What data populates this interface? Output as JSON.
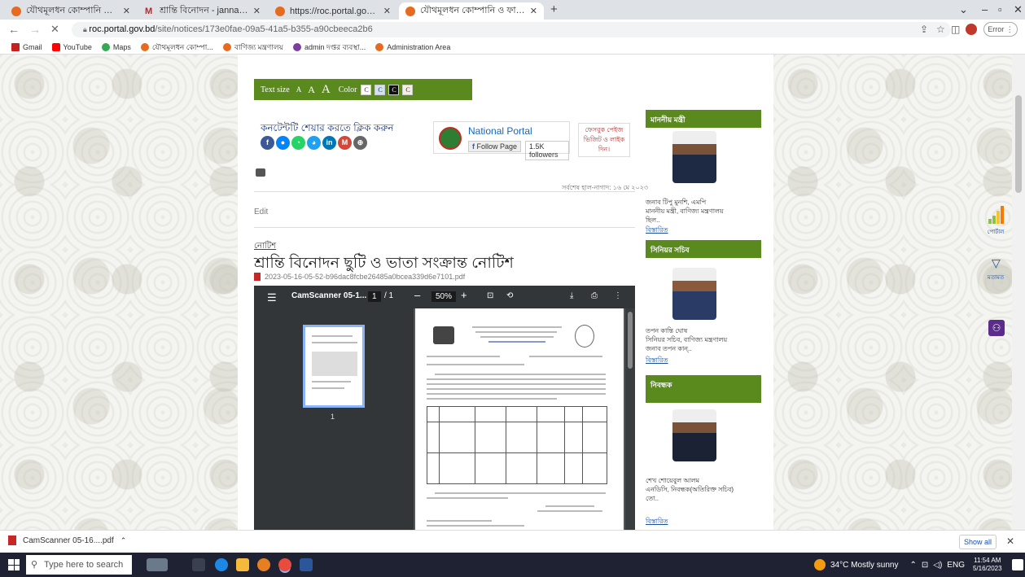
{
  "tabs": [
    {
      "title": "যৌথমূলধন কোম্পানি ও ফার্মসমূহে",
      "active": false,
      "icon": "roc-icon"
    },
    {
      "title": "শ্রান্তি বিনোদন - jannatulruma18",
      "active": false,
      "icon": "gmail-icon"
    },
    {
      "title": "https://roc.portal.gov.bd/npfadm",
      "active": false,
      "icon": "roc-icon"
    },
    {
      "title": "যৌথমূলধন কোম্পানি ও ফার্মসমূহে",
      "active": true,
      "icon": "roc-icon"
    }
  ],
  "new_tab": "+",
  "window": {
    "minimize": "–",
    "maximize": "▫",
    "close": "✕",
    "chevron": "⌄"
  },
  "omnibox": {
    "domain": "roc.portal.gov.bd",
    "path": "/site/notices/173e0fae-09a5-41a5-b355-a90cbeeca2b6"
  },
  "profile_error": "Error",
  "bookmarks": [
    {
      "label": "Gmail",
      "color": "#c5221f"
    },
    {
      "label": "YouTube",
      "color": "#ff0000"
    },
    {
      "label": "Maps",
      "color": "#34a853"
    },
    {
      "label": "যৌথমূলধন কোম্পা...",
      "color": "#e66a1f"
    },
    {
      "label": "বাণিজ্য মন্ত্রণালয়",
      "color": "#e66a1f"
    },
    {
      "label": "admin দপ্তর ব্যবস্থা...",
      "color": "#7b3fa0"
    },
    {
      "label": "Administration Area",
      "color": "#e66a1f"
    }
  ],
  "textsize": {
    "label": "Text size",
    "a_small": "A",
    "a_mid": "A",
    "a_large": "A",
    "color_label": "Color",
    "c": "C"
  },
  "share": {
    "title": "কনটেন্টটি শেয়ার করতে ক্লিক করুন",
    "icons": [
      {
        "name": "facebook",
        "color": "#3b5998",
        "glyph": "f"
      },
      {
        "name": "messenger",
        "color": "#0084ff",
        "glyph": "●"
      },
      {
        "name": "whatsapp",
        "color": "#25d366",
        "glyph": "◔"
      },
      {
        "name": "twitter",
        "color": "#1da1f2",
        "glyph": "◕"
      },
      {
        "name": "linkedin",
        "color": "#0077b5",
        "glyph": "in"
      },
      {
        "name": "gmail",
        "color": "#d44638",
        "glyph": "M"
      },
      {
        "name": "more",
        "color": "#666",
        "glyph": "⊕"
      }
    ]
  },
  "national_portal": {
    "title": "National Portal",
    "follow": "Follow Page",
    "followers": "1.5K followers"
  },
  "fb_note": "ফেসবুক পেইজ ভিজিট ও লাইক দিন।",
  "updated": "সর্বশেষ হাল-নাগাদ: ১৬ মে ২০২৩",
  "edit": "Edit",
  "category": "নোটিশ",
  "notice_title": "শ্রান্তি বিনোদন ছুটি ও ভাতা সংক্রান্ত নোটিশ",
  "pdf_file": "2023-05-16-05-52-b96dac8fcbe26485a0bcea339d6e7101.pdf",
  "viewer": {
    "name": "CamScanner 05-1...",
    "page": "1",
    "of": "/ 1",
    "zoom": "50%",
    "minus": "–",
    "plus": "+",
    "thumb_page": "1"
  },
  "sidebar": [
    {
      "header": "মাননীয় মন্ত্রী",
      "name": "জনাব টিপু মুনশি, এমপি",
      "role": "মাননীয় মন্ত্রী, বাণিজ্য মন্ত্রণালয়",
      "extra": "ছিল..",
      "more": "বিস্তারিত"
    },
    {
      "header": "সিনিয়র সচিব",
      "name": "তপন কান্তি ঘোষ",
      "role": "সিনিয়র সচিব, বাণিজ্য মন্ত্রণালয়",
      "extra": "জনাব তপন কান্..",
      "more": "বিস্তারিত"
    },
    {
      "header": "নিবন্ধক",
      "name": "শেখ শোয়েবুল আলম",
      "role": "এনডিসি, নিবন্ধক(অতিরিক্ত সচিব)",
      "extra": "তো..",
      "more": "বিস্তারিত"
    }
  ],
  "right_rail": {
    "portal_label": "পোর্টাল",
    "feedback_label": "মতামত"
  },
  "download": {
    "file": "CamScanner 05-16....pdf",
    "show_all": "Show all"
  },
  "taskbar": {
    "search": "Type here to search",
    "weather": "34°C  Mostly sunny",
    "lang": "ENG",
    "time": "11:54 AM",
    "date": "5/16/2023"
  }
}
